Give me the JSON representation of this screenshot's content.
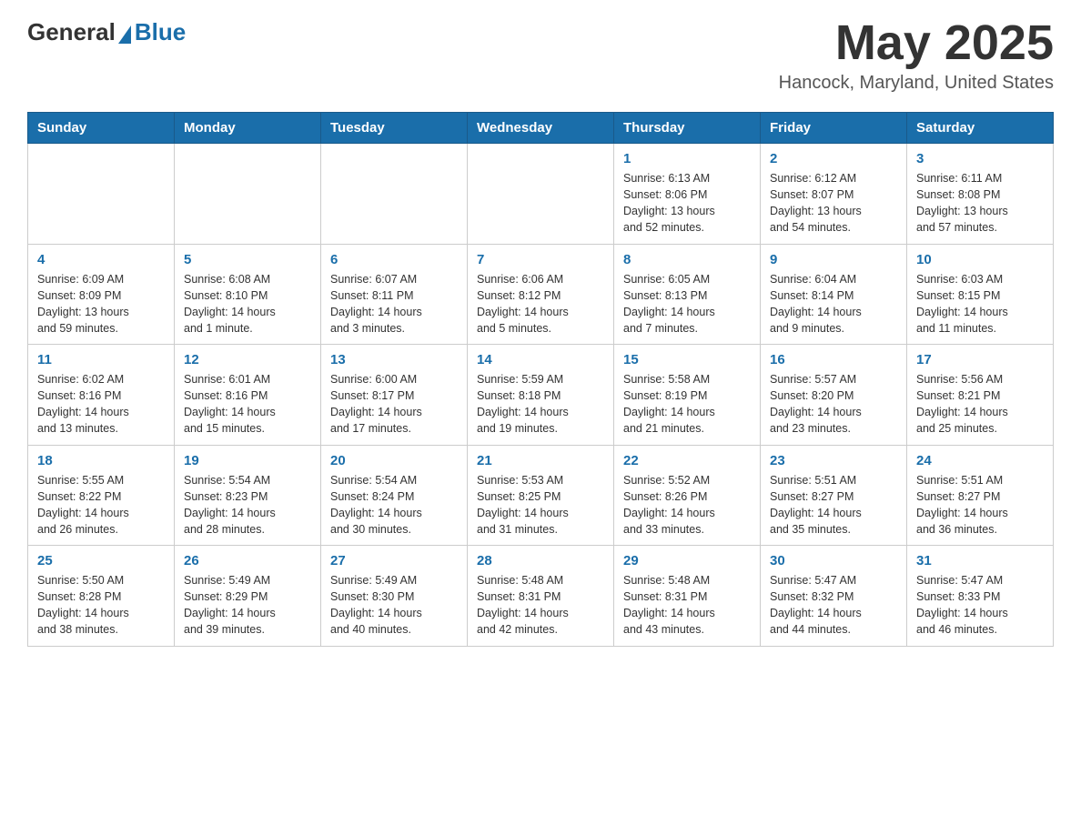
{
  "header": {
    "logo_general": "General",
    "logo_blue": "Blue",
    "month_year": "May 2025",
    "location": "Hancock, Maryland, United States"
  },
  "days_of_week": [
    "Sunday",
    "Monday",
    "Tuesday",
    "Wednesday",
    "Thursday",
    "Friday",
    "Saturday"
  ],
  "weeks": [
    [
      {
        "day": "",
        "info": ""
      },
      {
        "day": "",
        "info": ""
      },
      {
        "day": "",
        "info": ""
      },
      {
        "day": "",
        "info": ""
      },
      {
        "day": "1",
        "info": "Sunrise: 6:13 AM\nSunset: 8:06 PM\nDaylight: 13 hours\nand 52 minutes."
      },
      {
        "day": "2",
        "info": "Sunrise: 6:12 AM\nSunset: 8:07 PM\nDaylight: 13 hours\nand 54 minutes."
      },
      {
        "day": "3",
        "info": "Sunrise: 6:11 AM\nSunset: 8:08 PM\nDaylight: 13 hours\nand 57 minutes."
      }
    ],
    [
      {
        "day": "4",
        "info": "Sunrise: 6:09 AM\nSunset: 8:09 PM\nDaylight: 13 hours\nand 59 minutes."
      },
      {
        "day": "5",
        "info": "Sunrise: 6:08 AM\nSunset: 8:10 PM\nDaylight: 14 hours\nand 1 minute."
      },
      {
        "day": "6",
        "info": "Sunrise: 6:07 AM\nSunset: 8:11 PM\nDaylight: 14 hours\nand 3 minutes."
      },
      {
        "day": "7",
        "info": "Sunrise: 6:06 AM\nSunset: 8:12 PM\nDaylight: 14 hours\nand 5 minutes."
      },
      {
        "day": "8",
        "info": "Sunrise: 6:05 AM\nSunset: 8:13 PM\nDaylight: 14 hours\nand 7 minutes."
      },
      {
        "day": "9",
        "info": "Sunrise: 6:04 AM\nSunset: 8:14 PM\nDaylight: 14 hours\nand 9 minutes."
      },
      {
        "day": "10",
        "info": "Sunrise: 6:03 AM\nSunset: 8:15 PM\nDaylight: 14 hours\nand 11 minutes."
      }
    ],
    [
      {
        "day": "11",
        "info": "Sunrise: 6:02 AM\nSunset: 8:16 PM\nDaylight: 14 hours\nand 13 minutes."
      },
      {
        "day": "12",
        "info": "Sunrise: 6:01 AM\nSunset: 8:16 PM\nDaylight: 14 hours\nand 15 minutes."
      },
      {
        "day": "13",
        "info": "Sunrise: 6:00 AM\nSunset: 8:17 PM\nDaylight: 14 hours\nand 17 minutes."
      },
      {
        "day": "14",
        "info": "Sunrise: 5:59 AM\nSunset: 8:18 PM\nDaylight: 14 hours\nand 19 minutes."
      },
      {
        "day": "15",
        "info": "Sunrise: 5:58 AM\nSunset: 8:19 PM\nDaylight: 14 hours\nand 21 minutes."
      },
      {
        "day": "16",
        "info": "Sunrise: 5:57 AM\nSunset: 8:20 PM\nDaylight: 14 hours\nand 23 minutes."
      },
      {
        "day": "17",
        "info": "Sunrise: 5:56 AM\nSunset: 8:21 PM\nDaylight: 14 hours\nand 25 minutes."
      }
    ],
    [
      {
        "day": "18",
        "info": "Sunrise: 5:55 AM\nSunset: 8:22 PM\nDaylight: 14 hours\nand 26 minutes."
      },
      {
        "day": "19",
        "info": "Sunrise: 5:54 AM\nSunset: 8:23 PM\nDaylight: 14 hours\nand 28 minutes."
      },
      {
        "day": "20",
        "info": "Sunrise: 5:54 AM\nSunset: 8:24 PM\nDaylight: 14 hours\nand 30 minutes."
      },
      {
        "day": "21",
        "info": "Sunrise: 5:53 AM\nSunset: 8:25 PM\nDaylight: 14 hours\nand 31 minutes."
      },
      {
        "day": "22",
        "info": "Sunrise: 5:52 AM\nSunset: 8:26 PM\nDaylight: 14 hours\nand 33 minutes."
      },
      {
        "day": "23",
        "info": "Sunrise: 5:51 AM\nSunset: 8:27 PM\nDaylight: 14 hours\nand 35 minutes."
      },
      {
        "day": "24",
        "info": "Sunrise: 5:51 AM\nSunset: 8:27 PM\nDaylight: 14 hours\nand 36 minutes."
      }
    ],
    [
      {
        "day": "25",
        "info": "Sunrise: 5:50 AM\nSunset: 8:28 PM\nDaylight: 14 hours\nand 38 minutes."
      },
      {
        "day": "26",
        "info": "Sunrise: 5:49 AM\nSunset: 8:29 PM\nDaylight: 14 hours\nand 39 minutes."
      },
      {
        "day": "27",
        "info": "Sunrise: 5:49 AM\nSunset: 8:30 PM\nDaylight: 14 hours\nand 40 minutes."
      },
      {
        "day": "28",
        "info": "Sunrise: 5:48 AM\nSunset: 8:31 PM\nDaylight: 14 hours\nand 42 minutes."
      },
      {
        "day": "29",
        "info": "Sunrise: 5:48 AM\nSunset: 8:31 PM\nDaylight: 14 hours\nand 43 minutes."
      },
      {
        "day": "30",
        "info": "Sunrise: 5:47 AM\nSunset: 8:32 PM\nDaylight: 14 hours\nand 44 minutes."
      },
      {
        "day": "31",
        "info": "Sunrise: 5:47 AM\nSunset: 8:33 PM\nDaylight: 14 hours\nand 46 minutes."
      }
    ]
  ]
}
